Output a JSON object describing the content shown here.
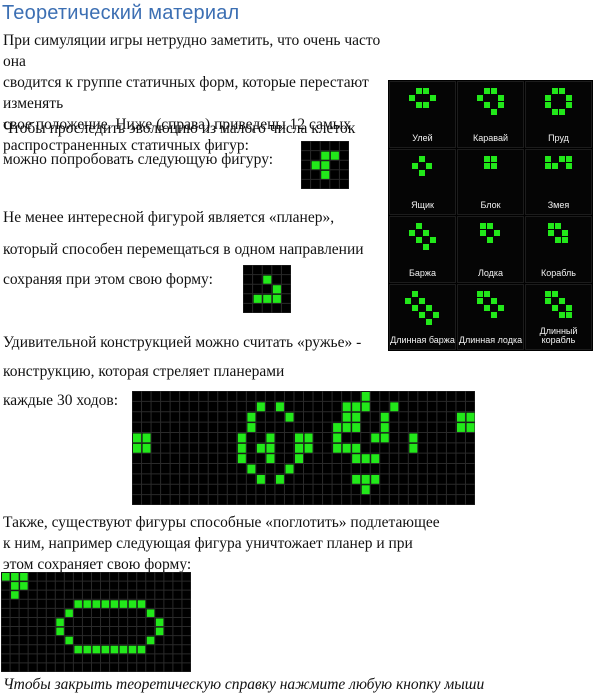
{
  "title": "Теоретический материал",
  "intro_lines": [
    "При симуляции игры нетрудно заметить, что очень часто она",
    "сводится к группе статичных форм, которые перестают изменять",
    "свое положение. Ниже (справа) приведены 12 самых",
    "распространенных статичных фигур:"
  ],
  "evolution_lines": [
    "Чтобы проследить эволюцию из малого числа клеток",
    "можно попробовать следующую фигуру:"
  ],
  "glider_lines": [
    "Не менее интересной фигурой является «планер»,",
    "который способен перемещаться в одном направлении",
    "сохраняя при этом свою форму:"
  ],
  "gun_lines": [
    "Удивительной конструкцией можно считать «ружье» -",
    "конструкцию, которая стреляет планерами",
    "каждые 30 ходов:"
  ],
  "eater_lines": [
    "Также, существуют фигуры способные «поглотить» подлетающее",
    "к ним, например следующая фигура уничтожает планер и при",
    "этом сохраняет свою форму:"
  ],
  "footer": "Чтобы закрыть теоретическую справку нажмите любую кнопку мыши",
  "colors": {
    "title": "#3c6fb3",
    "cell_alive": "#22e81a",
    "cell_grid": "#2a2a2a",
    "board_bg": "#000000"
  },
  "still_lifes": [
    {
      "name": "Улей",
      "cells": [
        [
          1,
          0
        ],
        [
          2,
          0
        ],
        [
          0,
          1
        ],
        [
          3,
          1
        ],
        [
          1,
          2
        ],
        [
          2,
          2
        ]
      ]
    },
    {
      "name": "Каравай",
      "cells": [
        [
          1,
          0
        ],
        [
          2,
          0
        ],
        [
          0,
          1
        ],
        [
          3,
          1
        ],
        [
          1,
          2
        ],
        [
          3,
          2
        ],
        [
          2,
          3
        ]
      ]
    },
    {
      "name": "Пруд",
      "cells": [
        [
          1,
          0
        ],
        [
          2,
          0
        ],
        [
          0,
          1
        ],
        [
          3,
          1
        ],
        [
          0,
          2
        ],
        [
          3,
          2
        ],
        [
          1,
          3
        ],
        [
          2,
          3
        ]
      ]
    },
    {
      "name": "Ящик",
      "cells": [
        [
          1,
          0
        ],
        [
          0,
          1
        ],
        [
          2,
          1
        ],
        [
          1,
          2
        ]
      ]
    },
    {
      "name": "Блок",
      "cells": [
        [
          0,
          0
        ],
        [
          1,
          0
        ],
        [
          0,
          1
        ],
        [
          1,
          1
        ]
      ]
    },
    {
      "name": "Змея",
      "cells": [
        [
          0,
          0
        ],
        [
          2,
          0
        ],
        [
          3,
          0
        ],
        [
          0,
          1
        ],
        [
          1,
          1
        ],
        [
          3,
          1
        ]
      ]
    },
    {
      "name": "Баржа",
      "cells": [
        [
          1,
          0
        ],
        [
          0,
          1
        ],
        [
          2,
          1
        ],
        [
          1,
          2
        ],
        [
          3,
          2
        ],
        [
          2,
          3
        ]
      ]
    },
    {
      "name": "Лодка",
      "cells": [
        [
          0,
          0
        ],
        [
          1,
          0
        ],
        [
          0,
          1
        ],
        [
          2,
          1
        ],
        [
          1,
          2
        ]
      ]
    },
    {
      "name": "Корабль",
      "cells": [
        [
          0,
          0
        ],
        [
          1,
          0
        ],
        [
          0,
          1
        ],
        [
          2,
          1
        ],
        [
          1,
          2
        ],
        [
          2,
          2
        ]
      ]
    },
    {
      "name": "Длинная баржа",
      "cells": [
        [
          1,
          0
        ],
        [
          0,
          1
        ],
        [
          2,
          1
        ],
        [
          1,
          2
        ],
        [
          3,
          2
        ],
        [
          2,
          3
        ],
        [
          4,
          3
        ],
        [
          3,
          4
        ]
      ]
    },
    {
      "name": "Длинная лодка",
      "cells": [
        [
          0,
          0
        ],
        [
          1,
          0
        ],
        [
          0,
          1
        ],
        [
          2,
          1
        ],
        [
          1,
          2
        ],
        [
          3,
          2
        ],
        [
          2,
          3
        ]
      ]
    },
    {
      "name": "Длинный корабль",
      "cells": [
        [
          0,
          0
        ],
        [
          1,
          0
        ],
        [
          0,
          1
        ],
        [
          2,
          1
        ],
        [
          1,
          2
        ],
        [
          3,
          2
        ],
        [
          2,
          3
        ],
        [
          3,
          3
        ]
      ]
    }
  ],
  "evolution_figure": {
    "cols": 5,
    "rows": 5,
    "cells": [
      [
        2,
        1
      ],
      [
        3,
        1
      ],
      [
        1,
        2
      ],
      [
        2,
        2
      ],
      [
        2,
        3
      ]
    ]
  },
  "glider_figure": {
    "cols": 5,
    "rows": 5,
    "cells": [
      [
        2,
        1
      ],
      [
        3,
        2
      ],
      [
        1,
        3
      ],
      [
        2,
        3
      ],
      [
        3,
        3
      ]
    ]
  },
  "gun_figure": {
    "cols": 36,
    "rows": 11,
    "cells": [
      [
        0,
        4
      ],
      [
        0,
        5
      ],
      [
        1,
        4
      ],
      [
        1,
        5
      ],
      [
        12,
        2
      ],
      [
        12,
        3
      ],
      [
        13,
        1
      ],
      [
        13,
        5
      ],
      [
        11,
        4
      ],
      [
        11,
        5
      ],
      [
        11,
        6
      ],
      [
        12,
        7
      ],
      [
        13,
        8
      ],
      [
        15,
        1
      ],
      [
        15,
        8
      ],
      [
        16,
        2
      ],
      [
        16,
        7
      ],
      [
        14,
        4
      ],
      [
        14,
        5
      ],
      [
        14,
        6
      ],
      [
        17,
        4
      ],
      [
        17,
        5
      ],
      [
        17,
        6
      ],
      [
        18,
        4
      ],
      [
        18,
        5
      ],
      [
        24,
        0
      ],
      [
        24,
        1
      ],
      [
        22,
        1
      ],
      [
        22,
        2
      ],
      [
        23,
        1
      ],
      [
        23,
        2
      ],
      [
        23,
        3
      ],
      [
        22,
        3
      ],
      [
        21,
        3
      ],
      [
        21,
        4
      ],
      [
        21,
        5
      ],
      [
        22,
        5
      ],
      [
        23,
        5
      ],
      [
        23,
        6
      ],
      [
        25,
        4
      ],
      [
        26,
        4
      ],
      [
        26,
        3
      ],
      [
        26,
        2
      ],
      [
        27,
        1
      ],
      [
        24,
        6
      ],
      [
        25,
        6
      ],
      [
        29,
        4
      ],
      [
        29,
        5
      ],
      [
        34,
        2
      ],
      [
        34,
        3
      ],
      [
        35,
        2
      ],
      [
        35,
        3
      ],
      [
        23,
        8
      ],
      [
        24,
        8
      ],
      [
        25,
        8
      ],
      [
        24,
        9
      ]
    ]
  },
  "eater_figure": {
    "cols": 21,
    "rows": 11,
    "cells": [
      [
        0,
        0
      ],
      [
        1,
        0
      ],
      [
        2,
        0
      ],
      [
        1,
        1
      ],
      [
        1,
        2
      ],
      [
        2,
        1
      ],
      [
        6,
        5
      ],
      [
        6,
        6
      ],
      [
        7,
        4
      ],
      [
        7,
        7
      ],
      [
        8,
        3
      ],
      [
        8,
        8
      ],
      [
        9,
        3
      ],
      [
        9,
        8
      ],
      [
        10,
        3
      ],
      [
        10,
        8
      ],
      [
        11,
        3
      ],
      [
        11,
        8
      ],
      [
        12,
        3
      ],
      [
        12,
        8
      ],
      [
        13,
        3
      ],
      [
        13,
        8
      ],
      [
        14,
        3
      ],
      [
        14,
        8
      ],
      [
        15,
        3
      ],
      [
        15,
        8
      ],
      [
        16,
        4
      ],
      [
        16,
        7
      ],
      [
        17,
        5
      ],
      [
        17,
        6
      ]
    ]
  }
}
